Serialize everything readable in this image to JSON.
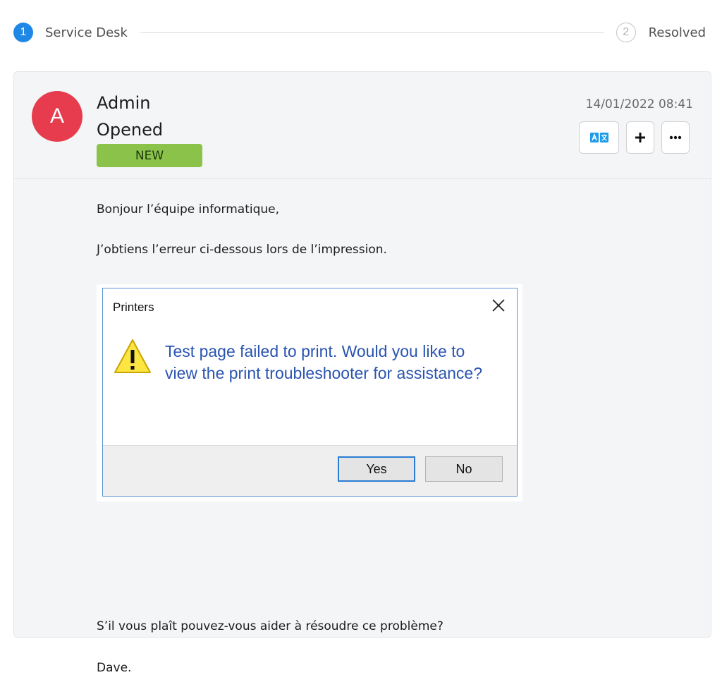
{
  "stepper": {
    "steps": [
      {
        "number": "1",
        "label": "Service Desk",
        "state": "active"
      },
      {
        "number": "2",
        "label": "Resolved",
        "state": "inactive"
      }
    ]
  },
  "ticket": {
    "avatar_initial": "A",
    "avatar_color": "#e63c4e",
    "author": "Admin",
    "action": "Opened",
    "status_badge": "NEW",
    "status_color": "#8bc34a",
    "timestamp": "14/01/2022 08:41",
    "actions": [
      {
        "icon": "translate-icon"
      },
      {
        "icon": "plus-icon"
      },
      {
        "icon": "more-icon"
      }
    ]
  },
  "message": {
    "greeting": "Bonjour l’équipe informatique,",
    "line1": "J’obtiens l’erreur ci-dessous lors de l’impression.",
    "line2": "S’il vous plaît pouvez-vous aider à résoudre ce problème?",
    "signature": "Dave."
  },
  "screenshot": {
    "title": "Printers",
    "message": "Test page failed to print. Would you like to view the print troubleshooter for assistance?",
    "yes_label": "Yes",
    "no_label": "No",
    "accent": "#2b7cd3"
  }
}
